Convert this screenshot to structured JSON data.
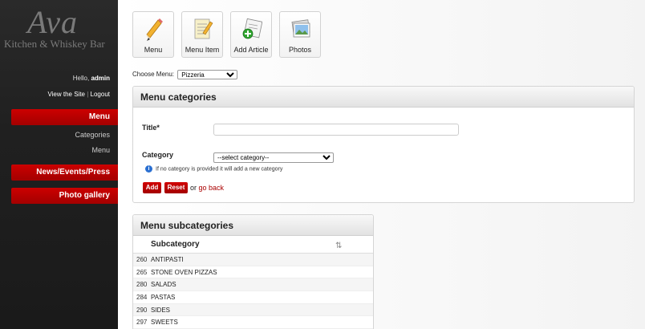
{
  "brand": {
    "name": "Ava",
    "tagline": "Kitchen & Whiskey Bar"
  },
  "user": {
    "greeting": "Hello,",
    "username": "admin",
    "view_site": "View the Site",
    "separator": "|",
    "logout": "Logout"
  },
  "sidebar": {
    "items": [
      {
        "label": "Menu",
        "active": true,
        "children": [
          "Categories",
          "Menu"
        ]
      },
      {
        "label": "News/Events/Press"
      },
      {
        "label": "Photo gallery"
      }
    ]
  },
  "toolbar": {
    "tiles": [
      {
        "label": "Menu",
        "icon": "pencil-icon"
      },
      {
        "label": "Menu Item",
        "icon": "notepad-icon"
      },
      {
        "label": "Add Article",
        "icon": "add-article-icon"
      },
      {
        "label": "Photos",
        "icon": "photos-icon"
      }
    ]
  },
  "choose_menu": {
    "label": "Choose Menu:",
    "value": "Pizzeria"
  },
  "categories_panel": {
    "title": "Menu categories",
    "title_label": "Title*",
    "title_value": "",
    "category_label": "Category",
    "category_value": "--select category--",
    "info_text": "If no category is provided it will add a new category",
    "add_label": "Add",
    "reset_label": "Reset",
    "or_text": "or",
    "go_back": "go back"
  },
  "subcategories_panel": {
    "title": "Menu subcategories",
    "column": "Subcategory",
    "rows": [
      {
        "id": "260",
        "name": "ANTIPASTI"
      },
      {
        "id": "265",
        "name": "STONE OVEN PIZZAS"
      },
      {
        "id": "280",
        "name": "SALADS"
      },
      {
        "id": "284",
        "name": "PASTAS"
      },
      {
        "id": "290",
        "name": "SIDES"
      },
      {
        "id": "297",
        "name": "SWEETS"
      }
    ]
  },
  "colors": {
    "accent": "#b80000",
    "sidebar": "#222222",
    "link": "#aa0000"
  }
}
